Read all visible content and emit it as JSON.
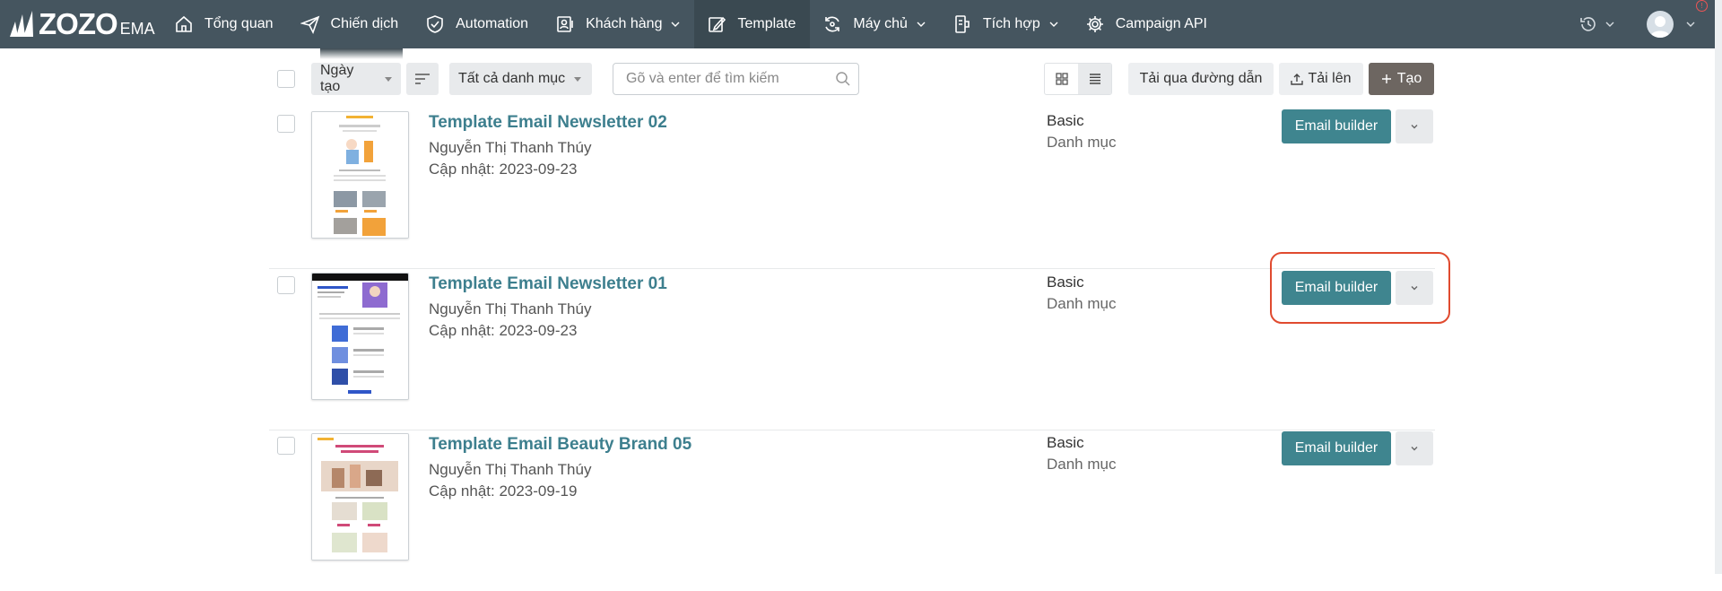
{
  "brand": {
    "logo_text": "ZOZO",
    "logo_sub": "EMA"
  },
  "nav": {
    "items": [
      {
        "label": "Tổng quan",
        "icon": "home-icon",
        "has_dropdown": false
      },
      {
        "label": "Chiến dịch",
        "icon": "send-icon",
        "has_dropdown": false
      },
      {
        "label": "Automation",
        "icon": "shield-check-icon",
        "has_dropdown": false
      },
      {
        "label": "Khách hàng",
        "icon": "contacts-icon",
        "has_dropdown": true
      },
      {
        "label": "Template",
        "icon": "edit-icon",
        "has_dropdown": false,
        "active": true
      },
      {
        "label": "Máy chủ",
        "icon": "server-sync-icon",
        "has_dropdown": true
      },
      {
        "label": "Tích hợp",
        "icon": "integration-icon",
        "has_dropdown": true
      },
      {
        "label": "Campaign API",
        "icon": "gear-icon",
        "has_dropdown": false
      }
    ]
  },
  "toolbar": {
    "sort_select": "Ngày tạo",
    "category_select": "Tất cả danh mục",
    "search_placeholder": "Gõ và enter để tìm kiếm",
    "import_url_label": "Tải qua đường dẫn",
    "upload_label": "Tải lên",
    "create_label": "Tạo"
  },
  "templates": [
    {
      "title": "Template Email Newsletter 02",
      "author": "Nguyễn Thị Thanh Thúy",
      "updated": "Cập nhật: 2023-09-23",
      "type": "Basic",
      "category": "Danh mục",
      "action_label": "Email builder"
    },
    {
      "title": "Template Email Newsletter 01",
      "author": "Nguyễn Thị Thanh Thúy",
      "updated": "Cập nhật: 2023-09-23",
      "type": "Basic",
      "category": "Danh mục",
      "action_label": "Email builder"
    },
    {
      "title": "Template Email Beauty Brand 05",
      "author": "Nguyễn Thị Thanh Thúy",
      "updated": "Cập nhật: 2023-09-19",
      "type": "Basic",
      "category": "Danh mục",
      "action_label": "Email builder"
    }
  ],
  "colors": {
    "nav_bg": "#45555f",
    "accent_teal": "#3f858f",
    "title_teal": "#3d7f8e",
    "create_btn": "#6d6661",
    "highlight": "#e04a2f"
  }
}
